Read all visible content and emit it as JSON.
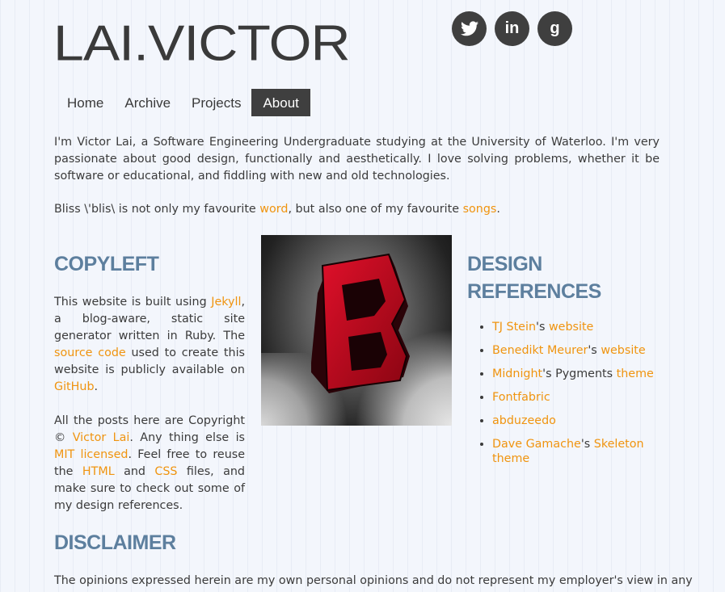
{
  "site": {
    "logo": "LAI.VICTOR"
  },
  "social": [
    {
      "name": "twitter",
      "glyph": "🐦"
    },
    {
      "name": "linkedin",
      "glyph": "in"
    },
    {
      "name": "google-plus",
      "glyph": "g"
    }
  ],
  "nav": {
    "items": [
      "Home",
      "Archive",
      "Projects",
      "About"
    ],
    "active": "About"
  },
  "intro": "I'm Victor Lai, a Software Engineering Undergraduate studying at the University of Waterloo. I'm very passionate about good design, functionally and aesthetically. I love solving problems, whether it be software or educational, and fiddling with new and old technologies.",
  "bliss": {
    "t1": "Bliss \\'blis\\ is not only my favourite ",
    "link1": "word",
    "t2": ", but also one of my favourite ",
    "link2": "songs",
    "t3": "."
  },
  "copyleft": {
    "heading": "Copyleft",
    "p1": {
      "t1": "This website is built using ",
      "jekyll": "Jekyll",
      "t2": ", a blog-aware, static site generator written in Ruby. The ",
      "source": "source code",
      "t3": " used to create this website is publicly available on ",
      "github": "GitHub",
      "t4": "."
    },
    "p2": {
      "t1": "All the posts here are Copyright © ",
      "name": "Victor Lai",
      "t2": ". Any thing else is ",
      "mit": "MIT licensed",
      "t3": ". Feel free to reuse the ",
      "html": "HTML",
      "t4": " and ",
      "css": "CSS",
      "t5": " files, and make sure to check out some of my design references."
    }
  },
  "image": {
    "alt": "B logo",
    "letter": "B"
  },
  "design": {
    "heading": "Design References",
    "refs": [
      {
        "a": "TJ Stein",
        "mid": "'s ",
        "b": "website"
      },
      {
        "a": "Benedikt Meurer",
        "mid": "'s ",
        "b": "website"
      },
      {
        "a": "Midnight",
        "mid": "'s Pygments ",
        "b": "theme"
      },
      {
        "a": "Fontfabric",
        "mid": "",
        "b": ""
      },
      {
        "a": "abduzeedo",
        "mid": "",
        "b": ""
      },
      {
        "a": "Dave Gamache",
        "mid": "'s ",
        "b": "Skeleton theme"
      }
    ]
  },
  "disclaimer": {
    "heading": "Disclaimer",
    "text": "The opinions expressed herein are my own personal opinions and do not represent my employer's view in any"
  },
  "colors": {
    "accent": "#f0940f",
    "heading": "#5d7f9e",
    "dark": "#3f3f3f",
    "background": "#f3f6fc"
  }
}
